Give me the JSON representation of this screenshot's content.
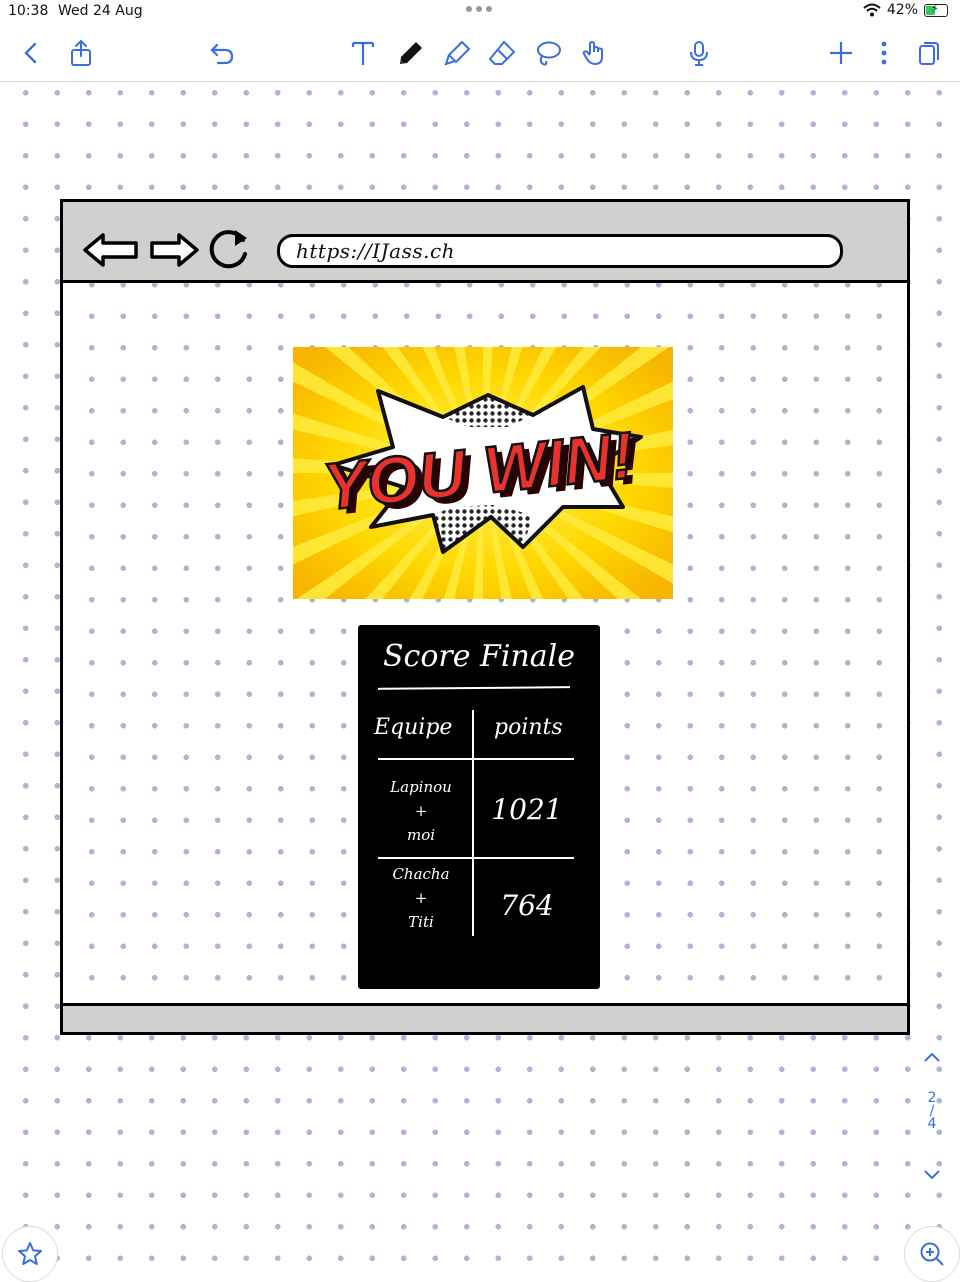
{
  "status": {
    "time": "10:38",
    "date": "Wed 24 Aug",
    "battery": "42%",
    "battery_level": 0.42
  },
  "toolbar": {
    "left": [
      "chevron-left-icon",
      "share-icon",
      "undo-icon"
    ],
    "tools": [
      "text-tool-icon",
      "pen-icon",
      "highlighter-icon",
      "eraser-icon",
      "lasso-icon",
      "hand-pointer-icon"
    ],
    "right": [
      "microphone-icon",
      "plus-icon",
      "more-vertical-icon",
      "pages-icon"
    ],
    "accent": "#3b6fe0"
  },
  "sketch": {
    "url": "https://IJass.ch",
    "banner_text": "YOU WIN!",
    "scoreboard": {
      "title": "Score Finale",
      "headers": [
        "Equipe",
        "points"
      ],
      "rows": [
        {
          "team_line1": "Lapinou",
          "team_line2": "+",
          "team_line3": "moi",
          "points": "1021"
        },
        {
          "team_line1": "Chacha",
          "team_line2": "+",
          "team_line3": "Titi",
          "points": "764"
        }
      ]
    }
  },
  "pager": {
    "current": "2",
    "separator": "/",
    "total": "4"
  }
}
